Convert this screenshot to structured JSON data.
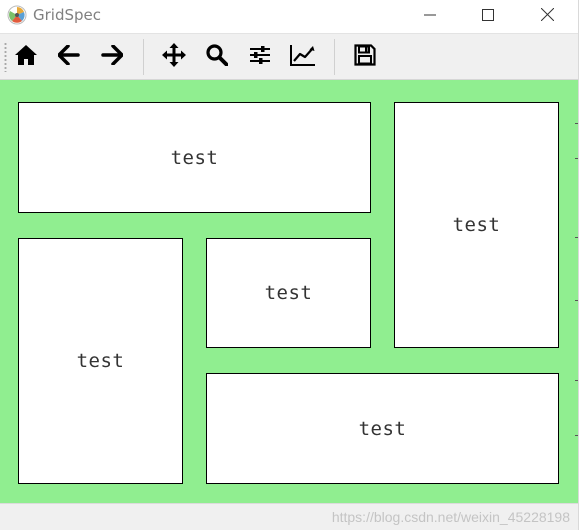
{
  "window": {
    "title": "GridSpec",
    "icon": "matplotlib-logo-icon",
    "controls": [
      "minimize-icon",
      "maximize-icon",
      "close-icon"
    ]
  },
  "toolbar": {
    "tools": [
      {
        "id": "home",
        "icon": "home-icon"
      },
      {
        "id": "back",
        "icon": "arrow-left-icon"
      },
      {
        "id": "forward",
        "icon": "arrow-right-icon"
      },
      {
        "id": "pan",
        "icon": "move-icon"
      },
      {
        "id": "zoom",
        "icon": "zoom-icon"
      },
      {
        "id": "subplots",
        "icon": "sliders-icon"
      },
      {
        "id": "customize",
        "icon": "line-chart-icon"
      },
      {
        "id": "save",
        "icon": "save-icon"
      }
    ]
  },
  "figure": {
    "background": "#90ee90",
    "axes": [
      {
        "id": "ax1",
        "label": "test"
      },
      {
        "id": "ax2",
        "label": "test"
      },
      {
        "id": "ax3",
        "label": "test"
      },
      {
        "id": "ax4",
        "label": "test"
      },
      {
        "id": "ax5",
        "label": "test"
      }
    ]
  },
  "statusbar": {
    "watermark": "https://blog.csdn.net/weixin_45228198"
  }
}
